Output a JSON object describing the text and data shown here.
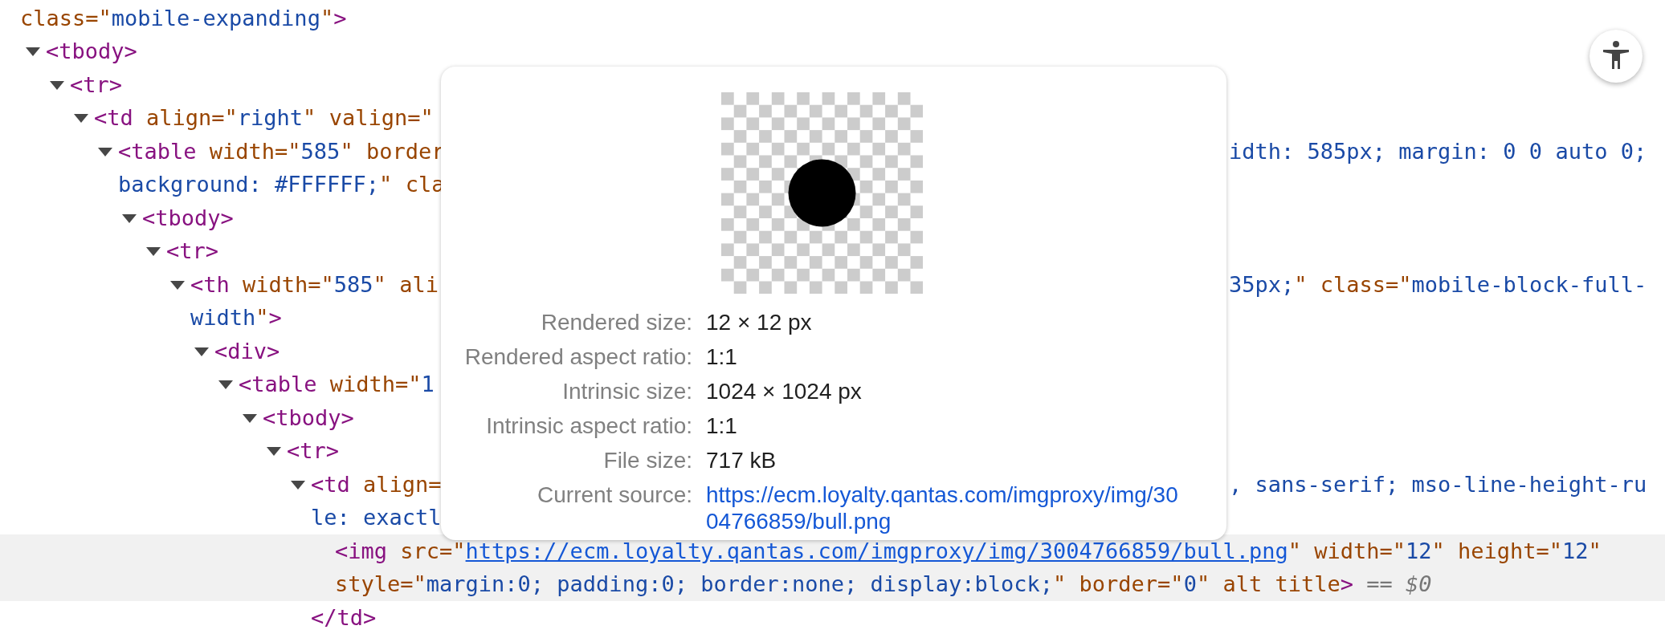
{
  "dom_tree": {
    "lines": [
      {
        "tokens": [
          {
            "kind": "attr",
            "text": "class=\""
          },
          {
            "kind": "value",
            "text": "mobile-expanding"
          },
          {
            "kind": "attr",
            "text": "\""
          },
          {
            "kind": "tag",
            "text": ">"
          }
        ]
      }
    ],
    "children": [
      {
        "expanded": true,
        "selected": false,
        "lines": [
          {
            "tokens": [
              {
                "kind": "tag",
                "text": "<tbody>"
              }
            ]
          }
        ],
        "children": [
          {
            "expanded": true,
            "selected": false,
            "lines": [
              {
                "tokens": [
                  {
                    "kind": "tag",
                    "text": "<tr>"
                  }
                ]
              }
            ],
            "children": [
              {
                "expanded": true,
                "selected": false,
                "lines": [
                  {
                    "tokens": [
                      {
                        "kind": "tag",
                        "text": "<td"
                      },
                      {
                        "kind": "attr",
                        "text": " align=\""
                      },
                      {
                        "kind": "value",
                        "text": "right"
                      },
                      {
                        "kind": "attr",
                        "text": "\""
                      },
                      {
                        "kind": "attr",
                        "text": " valign=\""
                      }
                    ]
                  }
                ],
                "children": [
                  {
                    "expanded": true,
                    "selected": false,
                    "lines": [
                      {
                        "tokens": [
                          {
                            "kind": "tag",
                            "text": "<table"
                          },
                          {
                            "kind": "attr",
                            "text": " width=\""
                          },
                          {
                            "kind": "value",
                            "text": "585"
                          },
                          {
                            "kind": "attr",
                            "text": "\""
                          },
                          {
                            "kind": "attr",
                            "text": " border"
                          }
                        ],
                        "right_tokens": [
                          {
                            "kind": "value",
                            "text": "idth: 585px; margin: 0 0 auto 0;"
                          }
                        ]
                      },
                      {
                        "tokens": [
                          {
                            "kind": "value",
                            "text": "background: #FFFFFF;"
                          },
                          {
                            "kind": "attr",
                            "text": "\""
                          },
                          {
                            "kind": "attr",
                            "text": " cla"
                          }
                        ]
                      }
                    ],
                    "children": [
                      {
                        "expanded": true,
                        "selected": false,
                        "lines": [
                          {
                            "tokens": [
                              {
                                "kind": "tag",
                                "text": "<tbody>"
                              }
                            ]
                          }
                        ],
                        "children": [
                          {
                            "expanded": true,
                            "selected": false,
                            "lines": [
                              {
                                "tokens": [
                                  {
                                    "kind": "tag",
                                    "text": "<tr>"
                                  }
                                ]
                              }
                            ],
                            "children": [
                              {
                                "expanded": true,
                                "selected": false,
                                "lines": [
                                  {
                                    "tokens": [
                                      {
                                        "kind": "tag",
                                        "text": "<th"
                                      },
                                      {
                                        "kind": "attr",
                                        "text": " width=\""
                                      },
                                      {
                                        "kind": "value",
                                        "text": "585"
                                      },
                                      {
                                        "kind": "attr",
                                        "text": "\""
                                      },
                                      {
                                        "kind": "attr",
                                        "text": " ali"
                                      }
                                    ],
                                    "right_tokens": [
                                      {
                                        "kind": "value",
                                        "text": "35px;"
                                      },
                                      {
                                        "kind": "attr",
                                        "text": "\""
                                      },
                                      {
                                        "kind": "attr",
                                        "text": " class=\""
                                      },
                                      {
                                        "kind": "value",
                                        "text": "mobile-block-full-"
                                      }
                                    ]
                                  },
                                  {
                                    "tokens": [
                                      {
                                        "kind": "value",
                                        "text": "width"
                                      },
                                      {
                                        "kind": "attr",
                                        "text": "\""
                                      },
                                      {
                                        "kind": "tag",
                                        "text": ">"
                                      }
                                    ]
                                  }
                                ],
                                "children": [
                                  {
                                    "expanded": true,
                                    "selected": false,
                                    "lines": [
                                      {
                                        "tokens": [
                                          {
                                            "kind": "tag",
                                            "text": "<div>"
                                          }
                                        ]
                                      }
                                    ],
                                    "children": [
                                      {
                                        "expanded": true,
                                        "selected": false,
                                        "lines": [
                                          {
                                            "tokens": [
                                              {
                                                "kind": "tag",
                                                "text": "<table"
                                              },
                                              {
                                                "kind": "attr",
                                                "text": " width=\""
                                              },
                                              {
                                                "kind": "value",
                                                "text": "1"
                                              }
                                            ]
                                          }
                                        ],
                                        "children": [
                                          {
                                            "expanded": true,
                                            "selected": false,
                                            "lines": [
                                              {
                                                "tokens": [
                                                  {
                                                    "kind": "tag",
                                                    "text": "<tbody>"
                                                  }
                                                ]
                                              }
                                            ],
                                            "children": [
                                              {
                                                "expanded": true,
                                                "selected": false,
                                                "lines": [
                                                  {
                                                    "tokens": [
                                                      {
                                                        "kind": "tag",
                                                        "text": "<tr>"
                                                      }
                                                    ]
                                                  }
                                                ],
                                                "children": [
                                                  {
                                                    "expanded": true,
                                                    "selected": false,
                                                    "lines": [
                                                      {
                                                        "tokens": [
                                                          {
                                                            "kind": "tag",
                                                            "text": "<td"
                                                          },
                                                          {
                                                            "kind": "attr",
                                                            "text": " align="
                                                          }
                                                        ],
                                                        "right_tokens": [
                                                          {
                                                            "kind": "value",
                                                            "text": ", sans-serif; mso-line-height-ru"
                                                          }
                                                        ]
                                                      },
                                                      {
                                                        "tokens": [
                                                          {
                                                            "kind": "value",
                                                            "text": "le: exactl"
                                                          }
                                                        ]
                                                      }
                                                    ],
                                                    "children": [
                                                      {
                                                        "selected": true,
                                                        "lines": [
                                                          {
                                                            "tokens": [
                                                              {
                                                                "kind": "tag",
                                                                "text": "<img"
                                                              },
                                                              {
                                                                "kind": "attr",
                                                                "text": " src=\""
                                                              },
                                                              {
                                                                "kind": "link",
                                                                "text": "https://ecm.loyalty.qantas.com/imgproxy/img/3004766859/bull.png"
                                                              },
                                                              {
                                                                "kind": "attr",
                                                                "text": "\""
                                                              },
                                                              {
                                                                "kind": "attr",
                                                                "text": " width=\""
                                                              },
                                                              {
                                                                "kind": "value",
                                                                "text": "12"
                                                              },
                                                              {
                                                                "kind": "attr",
                                                                "text": "\""
                                                              },
                                                              {
                                                                "kind": "attr",
                                                                "text": " height=\""
                                                              },
                                                              {
                                                                "kind": "value",
                                                                "text": "12"
                                                              },
                                                              {
                                                                "kind": "attr",
                                                                "text": "\""
                                                              }
                                                            ]
                                                          },
                                                          {
                                                            "tokens": [
                                                              {
                                                                "kind": "attr",
                                                                "text": "style=\""
                                                              },
                                                              {
                                                                "kind": "value",
                                                                "text": "margin:0; padding:0; border:none; display:block;"
                                                              },
                                                              {
                                                                "kind": "attr",
                                                                "text": "\""
                                                              },
                                                              {
                                                                "kind": "attr",
                                                                "text": " border=\""
                                                              },
                                                              {
                                                                "kind": "value",
                                                                "text": "0"
                                                              },
                                                              {
                                                                "kind": "attr",
                                                                "text": "\""
                                                              },
                                                              {
                                                                "kind": "attr",
                                                                "text": " alt title"
                                                              },
                                                              {
                                                                "kind": "tag",
                                                                "text": ">"
                                                              },
                                                              {
                                                                "kind": "hint",
                                                                "text": " == $0"
                                                              }
                                                            ]
                                                          }
                                                        ]
                                                      }
                                                    ],
                                                    "closing": [
                                                      {
                                                        "kind": "tag",
                                                        "text": "</td>"
                                                      }
                                                    ]
                                                  }
                                                ]
                                              }
                                            ]
                                          }
                                        ]
                                      }
                                    ]
                                  }
                                ]
                              }
                            ]
                          }
                        ]
                      }
                    ]
                  }
                ]
              }
            ]
          }
        ]
      }
    ]
  },
  "image_tooltip": {
    "properties": [
      {
        "label": "Rendered size:",
        "value": "12 × 12 px",
        "kind": "text"
      },
      {
        "label": "Rendered aspect ratio:",
        "value": "1:1",
        "kind": "text"
      },
      {
        "label": "Intrinsic size:",
        "value": "1024 × 1024 px",
        "kind": "text"
      },
      {
        "label": "Intrinsic aspect ratio:",
        "value": "1:1",
        "kind": "text"
      },
      {
        "label": "File size:",
        "value": "717 kB",
        "kind": "text"
      },
      {
        "label": "Current source:",
        "value": "https://ecm.loyalty.qantas.com/imgproxy/img/3004766859/bull.png",
        "kind": "link"
      }
    ]
  }
}
